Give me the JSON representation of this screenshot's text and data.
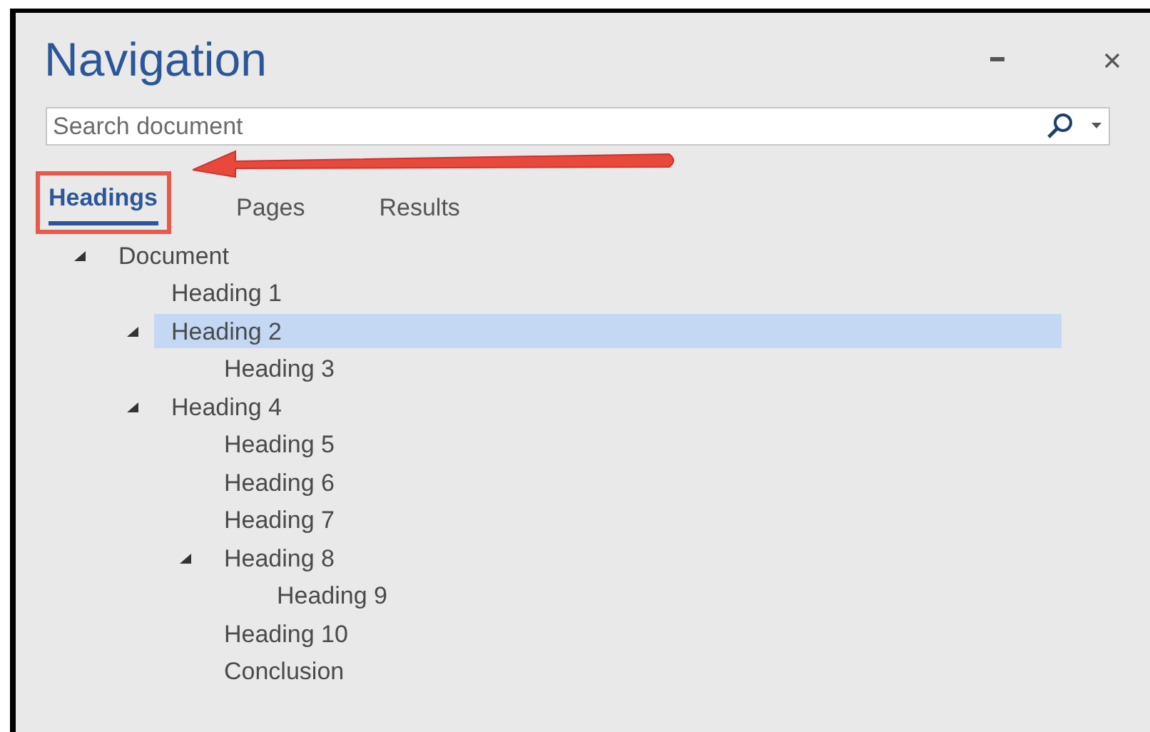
{
  "pane": {
    "title": "Navigation"
  },
  "search": {
    "placeholder": "Search document"
  },
  "tabs": [
    {
      "label": "Headings",
      "selected": true,
      "highlighted": true
    },
    {
      "label": "Pages",
      "selected": false,
      "highlighted": false
    },
    {
      "label": "Results",
      "selected": false,
      "highlighted": false
    }
  ],
  "tree": [
    {
      "label": "Document",
      "expanded": true,
      "selected": false,
      "children": [
        {
          "label": "Heading 1",
          "selected": false
        },
        {
          "label": "Heading 2",
          "expanded": true,
          "selected": true,
          "children": [
            {
              "label": "Heading 3",
              "selected": false
            }
          ]
        },
        {
          "label": "Heading 4",
          "expanded": true,
          "selected": false,
          "children": [
            {
              "label": "Heading 5",
              "selected": false
            },
            {
              "label": "Heading 6",
              "selected": false
            },
            {
              "label": "Heading 7",
              "selected": false
            },
            {
              "label": "Heading 8",
              "expanded": true,
              "selected": false,
              "children": [
                {
                  "label": "Heading 9",
                  "selected": false
                }
              ]
            },
            {
              "label": "Heading 10",
              "selected": false
            },
            {
              "label": "Conclusion",
              "selected": false
            }
          ]
        }
      ]
    }
  ]
}
